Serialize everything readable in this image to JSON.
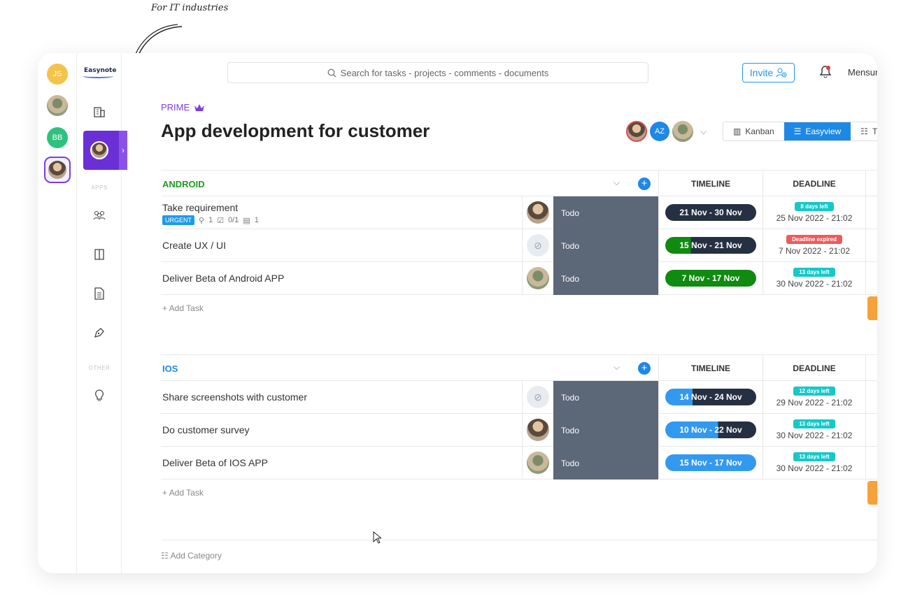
{
  "annotation": "For IT industries",
  "workspaces": [
    {
      "initials": "JS",
      "color": "#f5c24a"
    },
    {
      "initials": "",
      "color": ""
    },
    {
      "initials": "BB",
      "color": "#2ec27e"
    },
    {
      "initials": "",
      "color": ""
    }
  ],
  "logo": "Easynote",
  "sidebar": {
    "apps_label": "APPS",
    "other_label": "OTHER"
  },
  "search": {
    "placeholder": "Search for tasks - projects - comments - documents"
  },
  "invite_label": "Invite",
  "user_name": "Mensur",
  "project": {
    "badge": "PRIME",
    "title": "App development for customer"
  },
  "members": [
    {
      "initials": ""
    },
    {
      "initials": "AZ"
    },
    {
      "initials": ""
    }
  ],
  "views": [
    "Kanban",
    "Easyview",
    "T"
  ],
  "columns": {
    "timeline": "TIMELINE",
    "deadline": "DEADLINE"
  },
  "groups": [
    {
      "name": "ANDROID",
      "color": "#1e9b1e",
      "add_task": "+ Add Task",
      "tasks": [
        {
          "name": "Take requirement",
          "tag": "URGENT",
          "attachments": "1",
          "checklist": "0/1",
          "comments": "1",
          "status": "Todo",
          "timeline": "21 Nov - 30 Nov",
          "deadline_badge": "8 days left",
          "deadline_state": "ok",
          "deadline_date": "25 Nov 2022 - 21:02"
        },
        {
          "name": "Create UX / UI",
          "status": "Todo",
          "timeline": "15 Nov - 21 Nov",
          "deadline_badge": "Deadline expired",
          "deadline_state": "exp",
          "deadline_date": "7 Nov 2022 - 21:02"
        },
        {
          "name": "Deliver Beta of Android APP",
          "status": "Todo",
          "timeline": "7 Nov - 17 Nov",
          "deadline_badge": "13 days left",
          "deadline_state": "ok",
          "deadline_date": "30 Nov 2022 - 21:02"
        }
      ]
    },
    {
      "name": "IOS",
      "color": "#1e88e5",
      "add_task": "+ Add Task",
      "tasks": [
        {
          "name": "Share screenshots with customer",
          "status": "Todo",
          "timeline": "14 Nov - 24 Nov",
          "deadline_badge": "12 days left",
          "deadline_state": "ok",
          "deadline_date": "29 Nov 2022 - 21:02"
        },
        {
          "name": "Do customer survey",
          "status": "Todo",
          "timeline": "10 Nov - 22 Nov",
          "deadline_badge": "13 days left",
          "deadline_state": "ok",
          "deadline_date": "30 Nov 2022 - 21:02"
        },
        {
          "name": "Deliver Beta of IOS APP",
          "status": "Todo",
          "timeline": "15 Nov - 17 Nov",
          "deadline_badge": "13 days left",
          "deadline_state": "ok",
          "deadline_date": "30 Nov 2022 - 21:02"
        }
      ]
    }
  ],
  "add_category": "Add Category"
}
